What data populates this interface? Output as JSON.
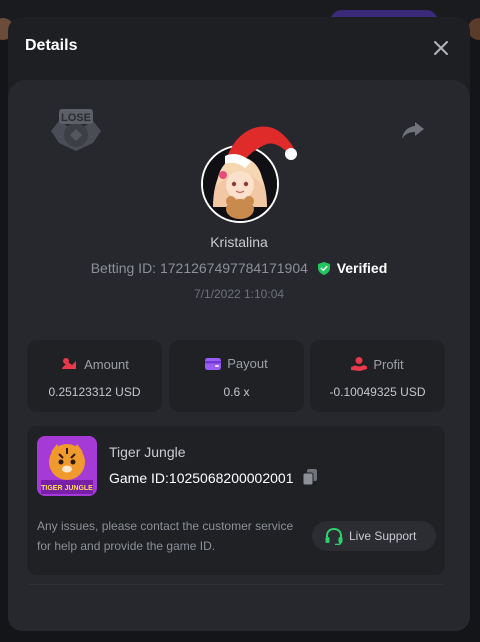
{
  "dialog": {
    "title": "Details"
  },
  "player": {
    "username": "Kristalina",
    "betting_id_label": "Betting ID:",
    "betting_id": "1721267497784171904",
    "verified_label": "Verified",
    "timestamp": "7/1/2022 1:10:04",
    "result_badge": "LOSE"
  },
  "stats": [
    {
      "label": "Amount",
      "value": "0.25123312 USD",
      "icon": "coins-icon"
    },
    {
      "label": "Payout",
      "value": "0.6 x",
      "icon": "wallet-icon"
    },
    {
      "label": "Profit",
      "value": "-0.10049325 USD",
      "icon": "hand-profit-icon"
    }
  ],
  "game": {
    "name": "Tiger Jungle",
    "id_label": "Game ID:",
    "id": "1025068200002001",
    "thumbnail_text": "TIGER JUNGLE"
  },
  "support": {
    "message": "Any issues, please contact the customer service for help and provide the game ID.",
    "button_label": "Live Support"
  },
  "colors": {
    "accent_red": "#e8394a",
    "accent_purple": "#9b5cf6",
    "verified_green": "#22c55e",
    "support_green": "#2fd06b"
  }
}
